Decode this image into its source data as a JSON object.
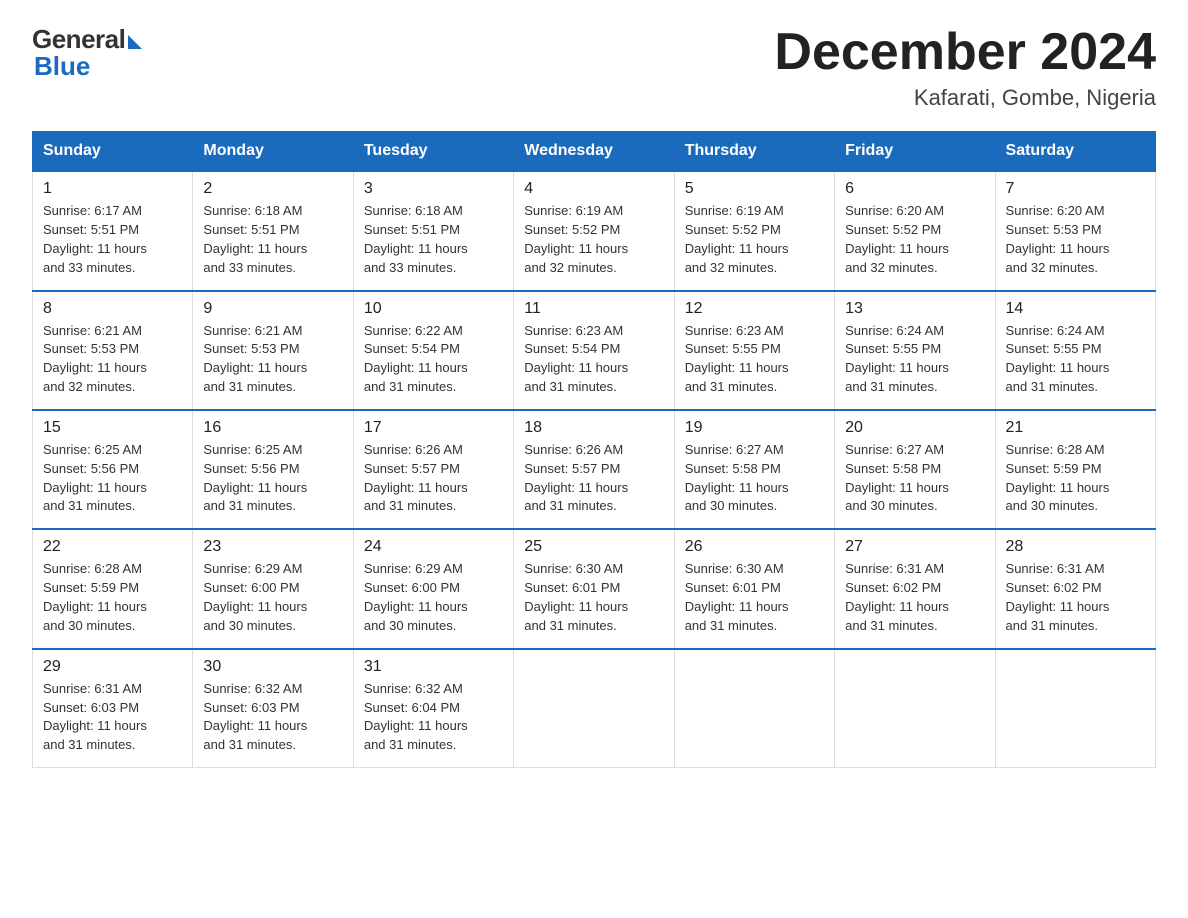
{
  "logo": {
    "general": "General",
    "blue": "Blue"
  },
  "title": {
    "month": "December 2024",
    "location": "Kafarati, Gombe, Nigeria"
  },
  "weekdays": [
    "Sunday",
    "Monday",
    "Tuesday",
    "Wednesday",
    "Thursday",
    "Friday",
    "Saturday"
  ],
  "weeks": [
    [
      {
        "day": "1",
        "sunrise": "6:17 AM",
        "sunset": "5:51 PM",
        "daylight": "11 hours and 33 minutes."
      },
      {
        "day": "2",
        "sunrise": "6:18 AM",
        "sunset": "5:51 PM",
        "daylight": "11 hours and 33 minutes."
      },
      {
        "day": "3",
        "sunrise": "6:18 AM",
        "sunset": "5:51 PM",
        "daylight": "11 hours and 33 minutes."
      },
      {
        "day": "4",
        "sunrise": "6:19 AM",
        "sunset": "5:52 PM",
        "daylight": "11 hours and 32 minutes."
      },
      {
        "day": "5",
        "sunrise": "6:19 AM",
        "sunset": "5:52 PM",
        "daylight": "11 hours and 32 minutes."
      },
      {
        "day": "6",
        "sunrise": "6:20 AM",
        "sunset": "5:52 PM",
        "daylight": "11 hours and 32 minutes."
      },
      {
        "day": "7",
        "sunrise": "6:20 AM",
        "sunset": "5:53 PM",
        "daylight": "11 hours and 32 minutes."
      }
    ],
    [
      {
        "day": "8",
        "sunrise": "6:21 AM",
        "sunset": "5:53 PM",
        "daylight": "11 hours and 32 minutes."
      },
      {
        "day": "9",
        "sunrise": "6:21 AM",
        "sunset": "5:53 PM",
        "daylight": "11 hours and 31 minutes."
      },
      {
        "day": "10",
        "sunrise": "6:22 AM",
        "sunset": "5:54 PM",
        "daylight": "11 hours and 31 minutes."
      },
      {
        "day": "11",
        "sunrise": "6:23 AM",
        "sunset": "5:54 PM",
        "daylight": "11 hours and 31 minutes."
      },
      {
        "day": "12",
        "sunrise": "6:23 AM",
        "sunset": "5:55 PM",
        "daylight": "11 hours and 31 minutes."
      },
      {
        "day": "13",
        "sunrise": "6:24 AM",
        "sunset": "5:55 PM",
        "daylight": "11 hours and 31 minutes."
      },
      {
        "day": "14",
        "sunrise": "6:24 AM",
        "sunset": "5:55 PM",
        "daylight": "11 hours and 31 minutes."
      }
    ],
    [
      {
        "day": "15",
        "sunrise": "6:25 AM",
        "sunset": "5:56 PM",
        "daylight": "11 hours and 31 minutes."
      },
      {
        "day": "16",
        "sunrise": "6:25 AM",
        "sunset": "5:56 PM",
        "daylight": "11 hours and 31 minutes."
      },
      {
        "day": "17",
        "sunrise": "6:26 AM",
        "sunset": "5:57 PM",
        "daylight": "11 hours and 31 minutes."
      },
      {
        "day": "18",
        "sunrise": "6:26 AM",
        "sunset": "5:57 PM",
        "daylight": "11 hours and 31 minutes."
      },
      {
        "day": "19",
        "sunrise": "6:27 AM",
        "sunset": "5:58 PM",
        "daylight": "11 hours and 30 minutes."
      },
      {
        "day": "20",
        "sunrise": "6:27 AM",
        "sunset": "5:58 PM",
        "daylight": "11 hours and 30 minutes."
      },
      {
        "day": "21",
        "sunrise": "6:28 AM",
        "sunset": "5:59 PM",
        "daylight": "11 hours and 30 minutes."
      }
    ],
    [
      {
        "day": "22",
        "sunrise": "6:28 AM",
        "sunset": "5:59 PM",
        "daylight": "11 hours and 30 minutes."
      },
      {
        "day": "23",
        "sunrise": "6:29 AM",
        "sunset": "6:00 PM",
        "daylight": "11 hours and 30 minutes."
      },
      {
        "day": "24",
        "sunrise": "6:29 AM",
        "sunset": "6:00 PM",
        "daylight": "11 hours and 30 minutes."
      },
      {
        "day": "25",
        "sunrise": "6:30 AM",
        "sunset": "6:01 PM",
        "daylight": "11 hours and 31 minutes."
      },
      {
        "day": "26",
        "sunrise": "6:30 AM",
        "sunset": "6:01 PM",
        "daylight": "11 hours and 31 minutes."
      },
      {
        "day": "27",
        "sunrise": "6:31 AM",
        "sunset": "6:02 PM",
        "daylight": "11 hours and 31 minutes."
      },
      {
        "day": "28",
        "sunrise": "6:31 AM",
        "sunset": "6:02 PM",
        "daylight": "11 hours and 31 minutes."
      }
    ],
    [
      {
        "day": "29",
        "sunrise": "6:31 AM",
        "sunset": "6:03 PM",
        "daylight": "11 hours and 31 minutes."
      },
      {
        "day": "30",
        "sunrise": "6:32 AM",
        "sunset": "6:03 PM",
        "daylight": "11 hours and 31 minutes."
      },
      {
        "day": "31",
        "sunrise": "6:32 AM",
        "sunset": "6:04 PM",
        "daylight": "11 hours and 31 minutes."
      },
      null,
      null,
      null,
      null
    ]
  ],
  "labels": {
    "sunrise": "Sunrise:",
    "sunset": "Sunset:",
    "daylight": "Daylight:"
  }
}
